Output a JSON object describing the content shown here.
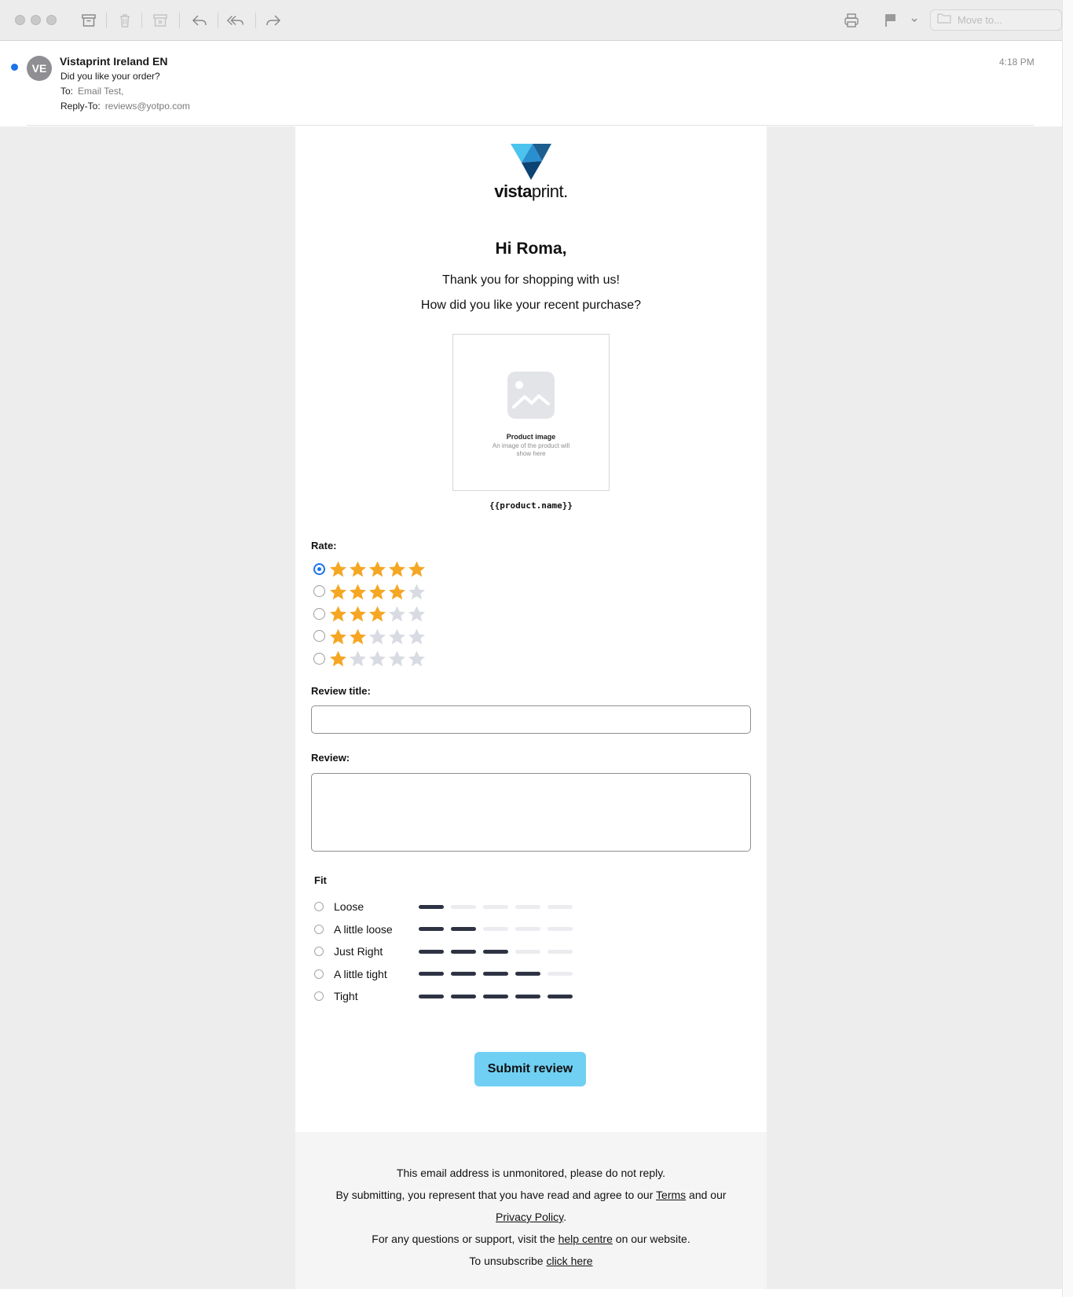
{
  "toolbar": {
    "move_to_placeholder": "Move to..."
  },
  "header": {
    "avatar_initials": "VE",
    "sender": "Vistaprint Ireland EN",
    "subject": "Did you like your order?",
    "to_label": "To:",
    "to_value": "Email Test,",
    "reply_to_label": "Reply-To:",
    "reply_to_value": "reviews@yotpo.com",
    "time": "4:18 PM"
  },
  "email": {
    "brand_bold": "vista",
    "brand_light": "print",
    "brand_mark": ".",
    "greeting": "Hi Roma,",
    "thanks": "Thank you for shopping with us!",
    "question": "How did you like your recent purchase?",
    "product_image_title": "Product image",
    "product_image_sub": "An image of the product will show here",
    "product_name": "{{product.name}}",
    "rate_label": "Rate:",
    "ratings": [
      {
        "stars": 5,
        "selected": true
      },
      {
        "stars": 4,
        "selected": false
      },
      {
        "stars": 3,
        "selected": false
      },
      {
        "stars": 2,
        "selected": false
      },
      {
        "stars": 1,
        "selected": false
      }
    ],
    "review_title_label": "Review title:",
    "review_title_value": "",
    "review_label": "Review:",
    "review_value": "",
    "fit_label": "Fit",
    "fit_options": [
      {
        "label": "Loose",
        "level": 1
      },
      {
        "label": "A little loose",
        "level": 2
      },
      {
        "label": "Just Right",
        "level": 3
      },
      {
        "label": "A little tight",
        "level": 4
      },
      {
        "label": "Tight",
        "level": 5
      }
    ],
    "submit_label": "Submit review"
  },
  "footer": {
    "line1": "This email address is unmonitored, please do not reply.",
    "line2_pre": "By submitting, you represent that you have read and agree to our ",
    "terms": "Terms",
    "line2_mid": " and our",
    "privacy": "Privacy Policy",
    "line3_post": ".",
    "line4_pre": "For any questions or support, visit the ",
    "help": "help centre",
    "line4_post": " on our website.",
    "line5_pre": "To unsubscribe ",
    "unsubscribe": "click here"
  },
  "colors": {
    "star_on": "#f5a623",
    "star_off": "#d9dbe3",
    "accent": "#1a73e8",
    "submit_bg": "#6fd0f3",
    "fit_on": "#2e3344"
  }
}
